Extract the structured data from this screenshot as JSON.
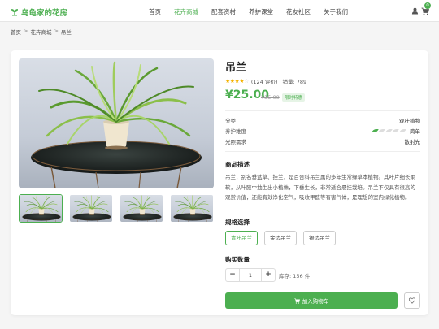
{
  "header": {
    "brand": "乌龟家的花房",
    "nav": [
      {
        "label": "首页",
        "active": false
      },
      {
        "label": "花卉商城",
        "active": true
      },
      {
        "label": "配套资材",
        "active": false
      },
      {
        "label": "养护课堂",
        "active": false
      },
      {
        "label": "花友社区",
        "active": false
      },
      {
        "label": "关于我们",
        "active": false
      }
    ],
    "cart_count": "0"
  },
  "breadcrumb": [
    "首页",
    "花卉商城",
    "吊兰"
  ],
  "product": {
    "name": "吊兰",
    "rating": 4.5,
    "reviews": "(124 评价)",
    "sales": "销量: 789",
    "price": "¥25.00",
    "old_price": "¥35.00",
    "promo_tag": "限时特惠",
    "attributes": [
      {
        "label": "分类",
        "value": "观叶植物"
      },
      {
        "label": "养护难度",
        "value": "简单",
        "level": 1,
        "max": 5
      },
      {
        "label": "光照需求",
        "value": "散射光"
      }
    ],
    "desc_title": "商品描述",
    "description": "吊兰，别名垂盆草、挂兰，是百合科吊兰属的多年生常绿草本植物。其叶片细长柔软，从叶腋中抽生出小植株，下垂生长，非常适合悬挂栽培。吊兰不仅具有很高的观赏价值，还能有效净化空气，吸收甲醛等有害气体，是理想的室内绿化植物。",
    "spec_title": "规格选择",
    "specs": [
      {
        "label": "青叶吊兰",
        "active": true
      },
      {
        "label": "金边吊兰",
        "active": false
      },
      {
        "label": "银边吊兰",
        "active": false
      }
    ],
    "qty_title": "购买数量",
    "quantity": "1",
    "stock": "库存: 156 件",
    "add_to_cart": "加入购物车"
  },
  "colors": {
    "accent": "#4caf50",
    "star": "#f5b301"
  },
  "icons": [
    "leaf-logo-icon",
    "user-icon",
    "cart-icon",
    "star-icon",
    "heart-icon",
    "minus-icon",
    "plus-icon"
  ]
}
